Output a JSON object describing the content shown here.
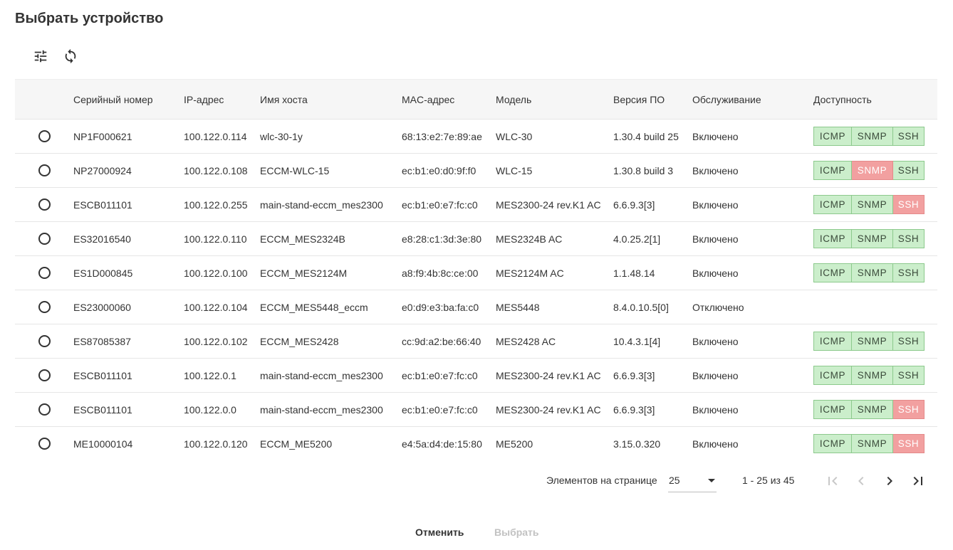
{
  "dialog": {
    "title": "Выбрать устройство"
  },
  "toolbar": {
    "filter_icon": "tune-icon",
    "refresh_icon": "refresh-icon"
  },
  "table": {
    "columns": [
      "Серийный номер",
      "IP-адрес",
      "Имя хоста",
      "MAC-адрес",
      "Модель",
      "Версия ПО",
      "Обслуживание",
      "Доступность"
    ],
    "rows": [
      {
        "serial": "NP1F000621",
        "ip": "100.122.0.114",
        "host": "wlc-30-1y",
        "mac": "68:13:e2:7e:89:ae",
        "model": "WLC-30",
        "version": "1.30.4 build 25",
        "service": "Включено",
        "avail": [
          {
            "label": "ICMP",
            "ok": true
          },
          {
            "label": "SNMP",
            "ok": true
          },
          {
            "label": "SSH",
            "ok": true
          }
        ]
      },
      {
        "serial": "NP27000924",
        "ip": "100.122.0.108",
        "host": "ECCM-WLC-15",
        "mac": "ec:b1:e0:d0:9f:f0",
        "model": "WLC-15",
        "version": "1.30.8 build 3",
        "service": "Включено",
        "avail": [
          {
            "label": "ICMP",
            "ok": true
          },
          {
            "label": "SNMP",
            "ok": false
          },
          {
            "label": "SSH",
            "ok": true
          }
        ]
      },
      {
        "serial": "ESCB011101",
        "ip": "100.122.0.255",
        "host": "main-stand-eccm_mes2300",
        "mac": "ec:b1:e0:e7:fc:c0",
        "model": "MES2300-24 rev.K1 AC",
        "version": "6.6.9.3[3]",
        "service": "Включено",
        "avail": [
          {
            "label": "ICMP",
            "ok": true
          },
          {
            "label": "SNMP",
            "ok": true
          },
          {
            "label": "SSH",
            "ok": false
          }
        ]
      },
      {
        "serial": "ES32016540",
        "ip": "100.122.0.110",
        "host": "ECCM_MES2324B",
        "mac": "e8:28:c1:3d:3e:80",
        "model": "MES2324B AC",
        "version": "4.0.25.2[1]",
        "service": "Включено",
        "avail": [
          {
            "label": "ICMP",
            "ok": true
          },
          {
            "label": "SNMP",
            "ok": true
          },
          {
            "label": "SSH",
            "ok": true
          }
        ]
      },
      {
        "serial": "ES1D000845",
        "ip": "100.122.0.100",
        "host": "ECCM_MES2124M",
        "mac": "a8:f9:4b:8c:ce:00",
        "model": "MES2124M AC",
        "version": "1.1.48.14",
        "service": "Включено",
        "avail": [
          {
            "label": "ICMP",
            "ok": true
          },
          {
            "label": "SNMP",
            "ok": true
          },
          {
            "label": "SSH",
            "ok": true
          }
        ]
      },
      {
        "serial": "ES23000060",
        "ip": "100.122.0.104",
        "host": "ECCM_MES5448_eccm",
        "mac": "e0:d9:e3:ba:fa:c0",
        "model": "MES5448",
        "version": "8.4.0.10.5[0]",
        "service": "Отключено",
        "avail": []
      },
      {
        "serial": "ES87085387",
        "ip": "100.122.0.102",
        "host": "ECCM_MES2428",
        "mac": "cc:9d:a2:be:66:40",
        "model": "MES2428 AC",
        "version": "10.4.3.1[4]",
        "service": "Включено",
        "avail": [
          {
            "label": "ICMP",
            "ok": true
          },
          {
            "label": "SNMP",
            "ok": true
          },
          {
            "label": "SSH",
            "ok": true
          }
        ]
      },
      {
        "serial": "ESCB011101",
        "ip": "100.122.0.1",
        "host": "main-stand-eccm_mes2300",
        "mac": "ec:b1:e0:e7:fc:c0",
        "model": "MES2300-24 rev.K1 AC",
        "version": "6.6.9.3[3]",
        "service": "Включено",
        "avail": [
          {
            "label": "ICMP",
            "ok": true
          },
          {
            "label": "SNMP",
            "ok": true
          },
          {
            "label": "SSH",
            "ok": true
          }
        ]
      },
      {
        "serial": "ESCB011101",
        "ip": "100.122.0.0",
        "host": "main-stand-eccm_mes2300",
        "mac": "ec:b1:e0:e7:fc:c0",
        "model": "MES2300-24 rev.K1 AC",
        "version": "6.6.9.3[3]",
        "service": "Включено",
        "avail": [
          {
            "label": "ICMP",
            "ok": true
          },
          {
            "label": "SNMP",
            "ok": true
          },
          {
            "label": "SSH",
            "ok": false
          }
        ]
      },
      {
        "serial": "ME10000104",
        "ip": "100.122.0.120",
        "host": "ECCM_ME5200",
        "mac": "e4:5a:d4:de:15:80",
        "model": "ME5200",
        "version": "3.15.0.320",
        "service": "Включено",
        "avail": [
          {
            "label": "ICMP",
            "ok": true
          },
          {
            "label": "SNMP",
            "ok": true
          },
          {
            "label": "SSH",
            "ok": false
          }
        ]
      }
    ]
  },
  "paginator": {
    "label": "Элементов на странице",
    "page_size": "25",
    "range": "1 - 25 из 45"
  },
  "footer": {
    "cancel_label": "Отменить",
    "select_label": "Выбрать"
  },
  "colors": {
    "ok_bg": "#cbeecb",
    "bad_bg": "#f2a0a0",
    "header_bg": "#f6f6f6"
  }
}
